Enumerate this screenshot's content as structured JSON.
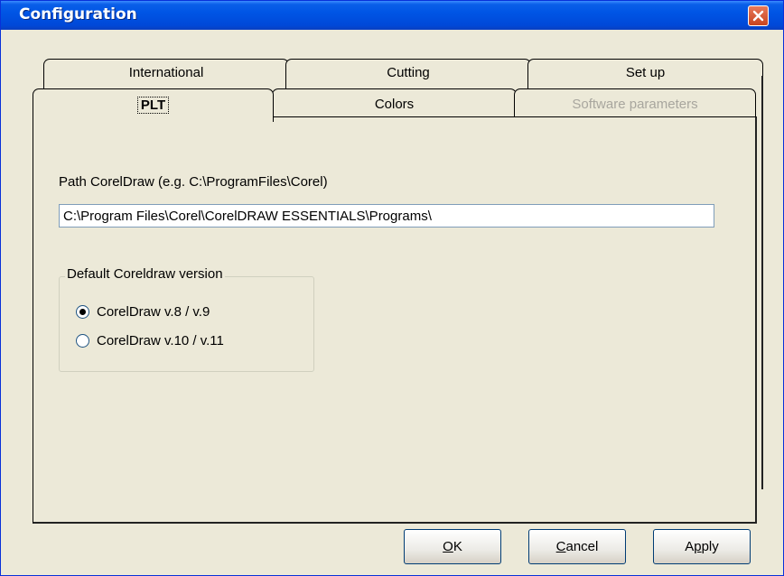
{
  "window": {
    "title": "Configuration"
  },
  "tabs": {
    "back_row": [
      {
        "label": "International"
      },
      {
        "label": "Cutting"
      },
      {
        "label": "Set up"
      }
    ],
    "front_row": [
      {
        "label": "PLT",
        "selected": true
      },
      {
        "label": "Colors"
      },
      {
        "label": "Software parameters",
        "disabled": true
      }
    ]
  },
  "plt": {
    "path_label": "Path CorelDraw (e.g. C:\\ProgramFiles\\Corel)",
    "path_value": "C:\\Program Files\\Corel\\CorelDRAW ESSENTIALS\\Programs\\",
    "group_title": "Default Coreldraw version",
    "options": [
      {
        "label": "CorelDraw v.8 / v.9",
        "checked": true
      },
      {
        "label": "CorelDraw v.10 / v.11",
        "checked": false
      }
    ]
  },
  "buttons": {
    "ok": {
      "mnemonic": "O",
      "rest": "K"
    },
    "cancel": {
      "mnemonic": "C",
      "rest": "ancel"
    },
    "apply": {
      "prefix": "A",
      "mnemonic": "p",
      "rest": "ply"
    }
  },
  "colors": {
    "titlebar": "#0055E5",
    "face": "#ECE9D8",
    "close": "#C8441F"
  }
}
